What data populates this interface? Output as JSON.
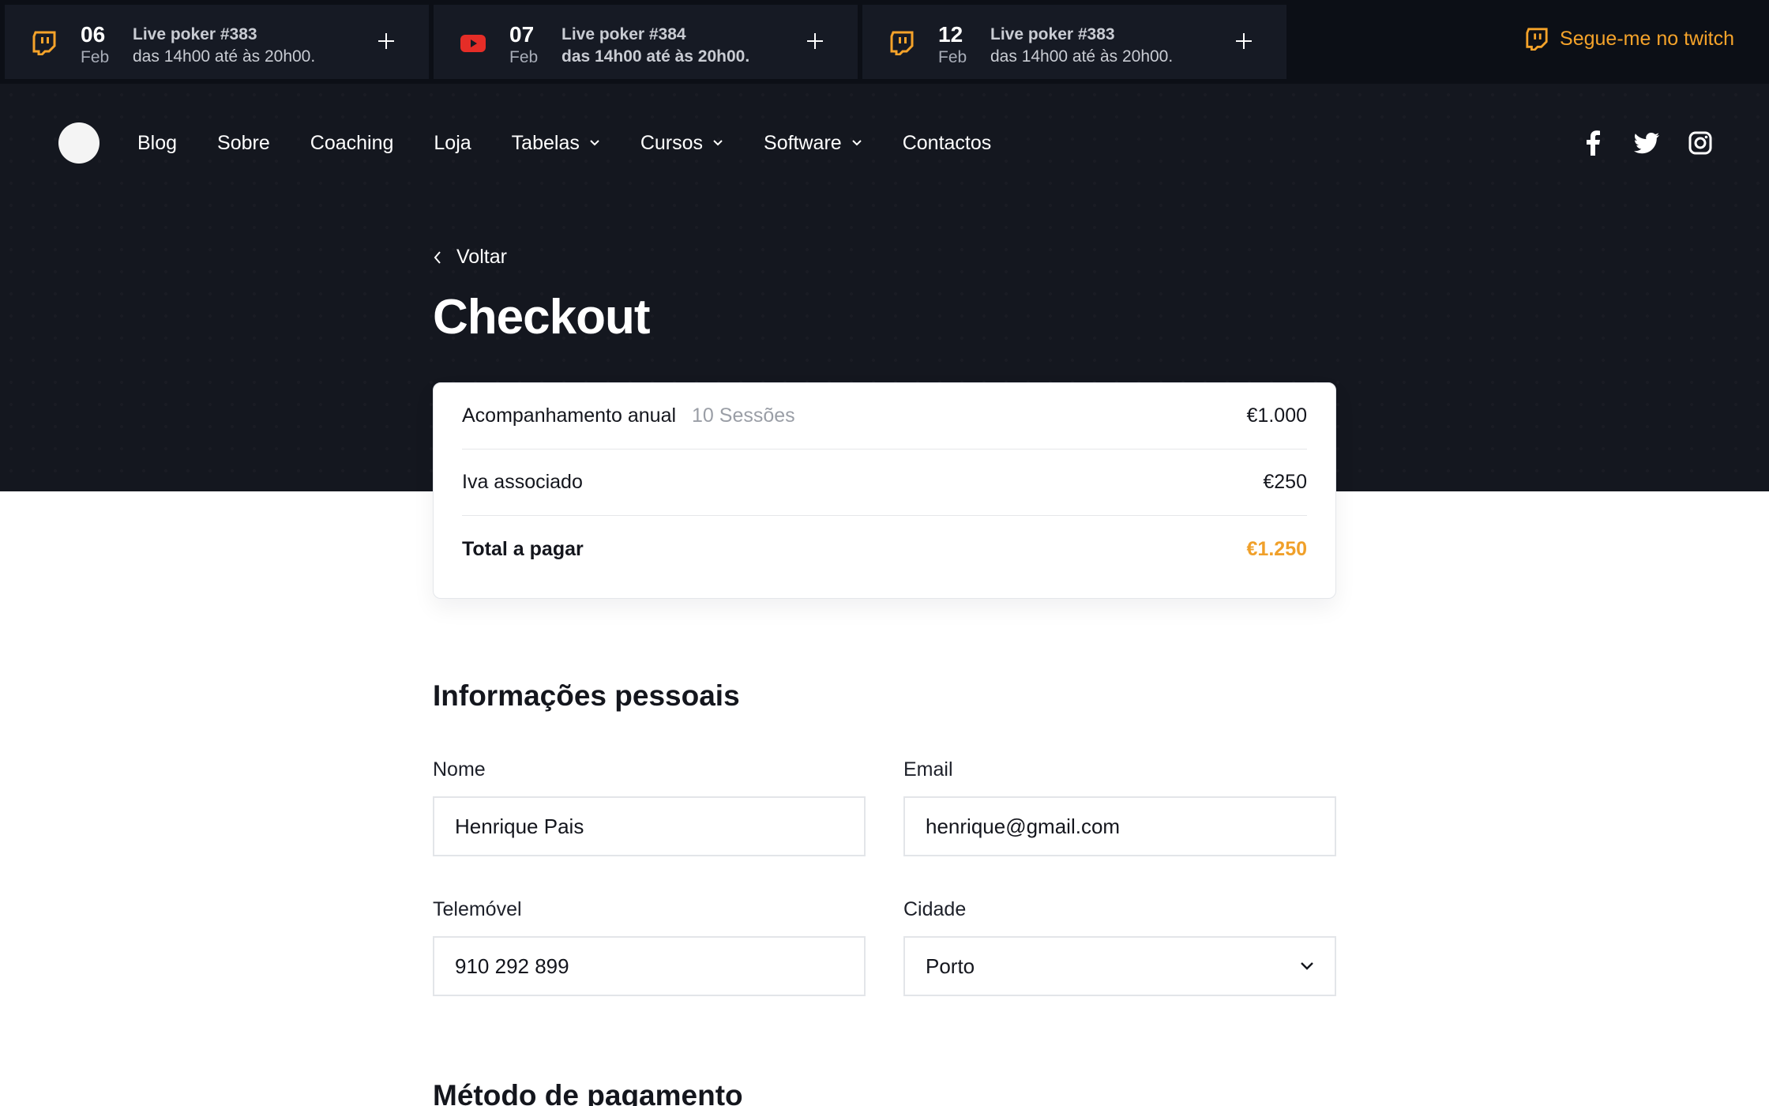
{
  "events": [
    {
      "platform": "twitch-icon",
      "day": "06",
      "month": "Feb",
      "title": "Live poker #383",
      "time": "das 14h00 até às 20h00."
    },
    {
      "platform": "youtube-icon",
      "day": "07",
      "month": "Feb",
      "title": "Live poker #384",
      "time": "das 14h00 até às 20h00."
    },
    {
      "platform": "twitch-icon",
      "day": "12",
      "month": "Feb",
      "title": "Live poker #383",
      "time": "das 14h00 até às 20h00."
    }
  ],
  "follow_twitch": "Segue-me no twitch",
  "nav": {
    "items": [
      "Blog",
      "Sobre",
      "Coaching",
      "Loja",
      "Tabelas",
      "Cursos",
      "Software",
      "Contactos"
    ],
    "social": [
      "facebook-icon",
      "twitter-icon",
      "instagram-icon"
    ]
  },
  "back_label": "Voltar",
  "page_title": "Checkout",
  "summary": {
    "item_label": "Acompanhamento anual",
    "item_detail": "10 Sessões",
    "item_price": "€1.000",
    "tax_label": "Iva associado",
    "tax_price": "€250",
    "total_label": "Total a pagar",
    "total_price": "€1.250"
  },
  "personal": {
    "title": "Informações pessoais",
    "name_label": "Nome",
    "name_value": "Henrique Pais",
    "email_label": "Email",
    "email_value": "henrique@gmail.com",
    "phone_label": "Telemóvel",
    "phone_value": "910 292 899",
    "city_label": "Cidade",
    "city_value": "Porto"
  },
  "payment_title": "Método de pagamento",
  "colors": {
    "accent": "#f0a02a",
    "twitch": "#f5a32a",
    "youtube": "#e52d27",
    "dark": "#14171f"
  }
}
